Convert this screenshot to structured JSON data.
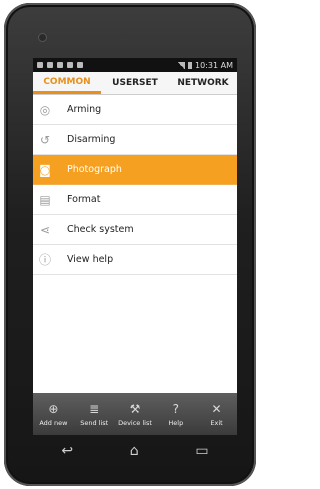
{
  "status": {
    "time": "10:31 AM"
  },
  "tabs": [
    {
      "label": "COMMON",
      "active": true
    },
    {
      "label": "USERSET",
      "active": false
    },
    {
      "label": "NETWORK",
      "active": false
    }
  ],
  "menu": [
    {
      "label": "Arming",
      "icon": "eye-icon",
      "glyph": "◎"
    },
    {
      "label": "Disarming",
      "icon": "undo-icon",
      "glyph": "↺"
    },
    {
      "label": "Photograph",
      "icon": "camera-icon",
      "glyph": "◙",
      "selected": true
    },
    {
      "label": "Format",
      "icon": "save-icon",
      "glyph": "▤"
    },
    {
      "label": "Check system",
      "icon": "share-icon",
      "glyph": "⋖"
    },
    {
      "label": "View help",
      "icon": "help-bubble-icon",
      "glyph": "ⓘ"
    }
  ],
  "bottom": [
    {
      "label": "Add new",
      "icon": "plus-circle-icon",
      "glyph": "⊕"
    },
    {
      "label": "Send list",
      "icon": "list-icon",
      "glyph": "≣"
    },
    {
      "label": "Device list",
      "icon": "wrench-icon",
      "glyph": "⚒"
    },
    {
      "label": "Help",
      "icon": "question-icon",
      "glyph": "?"
    },
    {
      "label": "Exit",
      "icon": "close-icon",
      "glyph": "✕"
    }
  ],
  "colors": {
    "accent": "#e8901a",
    "selected_row": "#f5a020"
  }
}
